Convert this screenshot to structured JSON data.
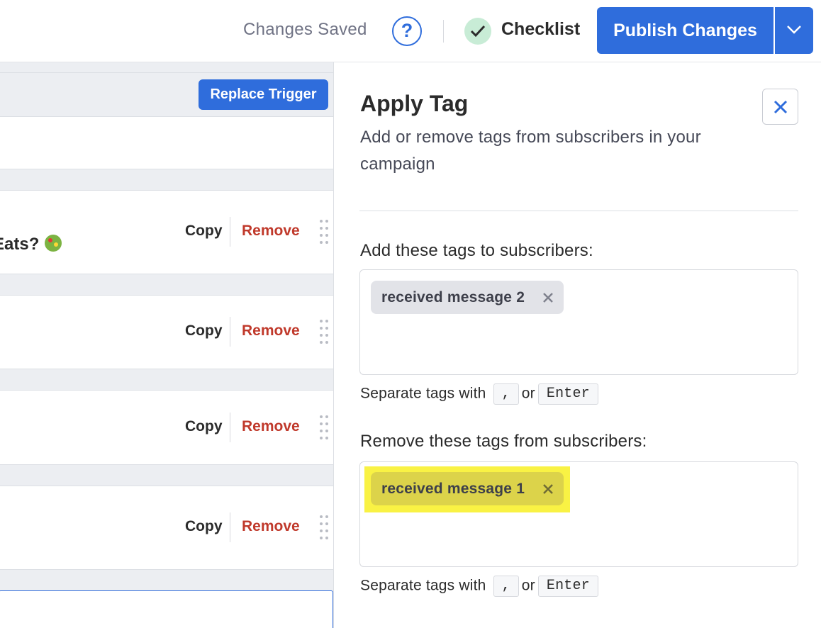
{
  "topbar": {
    "save_status": "Changes Saved",
    "help_glyph": "?",
    "checklist_label": "Checklist",
    "publish_label": "Publish Changes",
    "accent_color": "#2f6ddc"
  },
  "flow": {
    "replace_trigger_label": "Replace Trigger",
    "steps": [
      {
        "title_fragment": "Eats?",
        "copy_label": "Copy",
        "remove_label": "Remove"
      },
      {
        "copy_label": "Copy",
        "remove_label": "Remove"
      },
      {
        "copy_label": "Copy",
        "remove_label": "Remove"
      },
      {
        "copy_label": "Copy",
        "remove_label": "Remove"
      }
    ]
  },
  "panel": {
    "title": "Apply Tag",
    "description": "Add or remove tags from subscribers in your campaign",
    "add_section": {
      "label": "Add these tags to subscribers:",
      "tags": [
        "received message 2"
      ],
      "hint_prefix": "Separate tags with",
      "hint_key1": ",",
      "hint_or": "or",
      "hint_key2": "Enter"
    },
    "remove_section": {
      "label": "Remove these tags from subscribers:",
      "tags": [
        "received message 1"
      ],
      "hint_prefix": "Separate tags with",
      "hint_key1": ",",
      "hint_or": "or",
      "hint_key2": "Enter",
      "highlight_color": "#f9f244"
    }
  }
}
